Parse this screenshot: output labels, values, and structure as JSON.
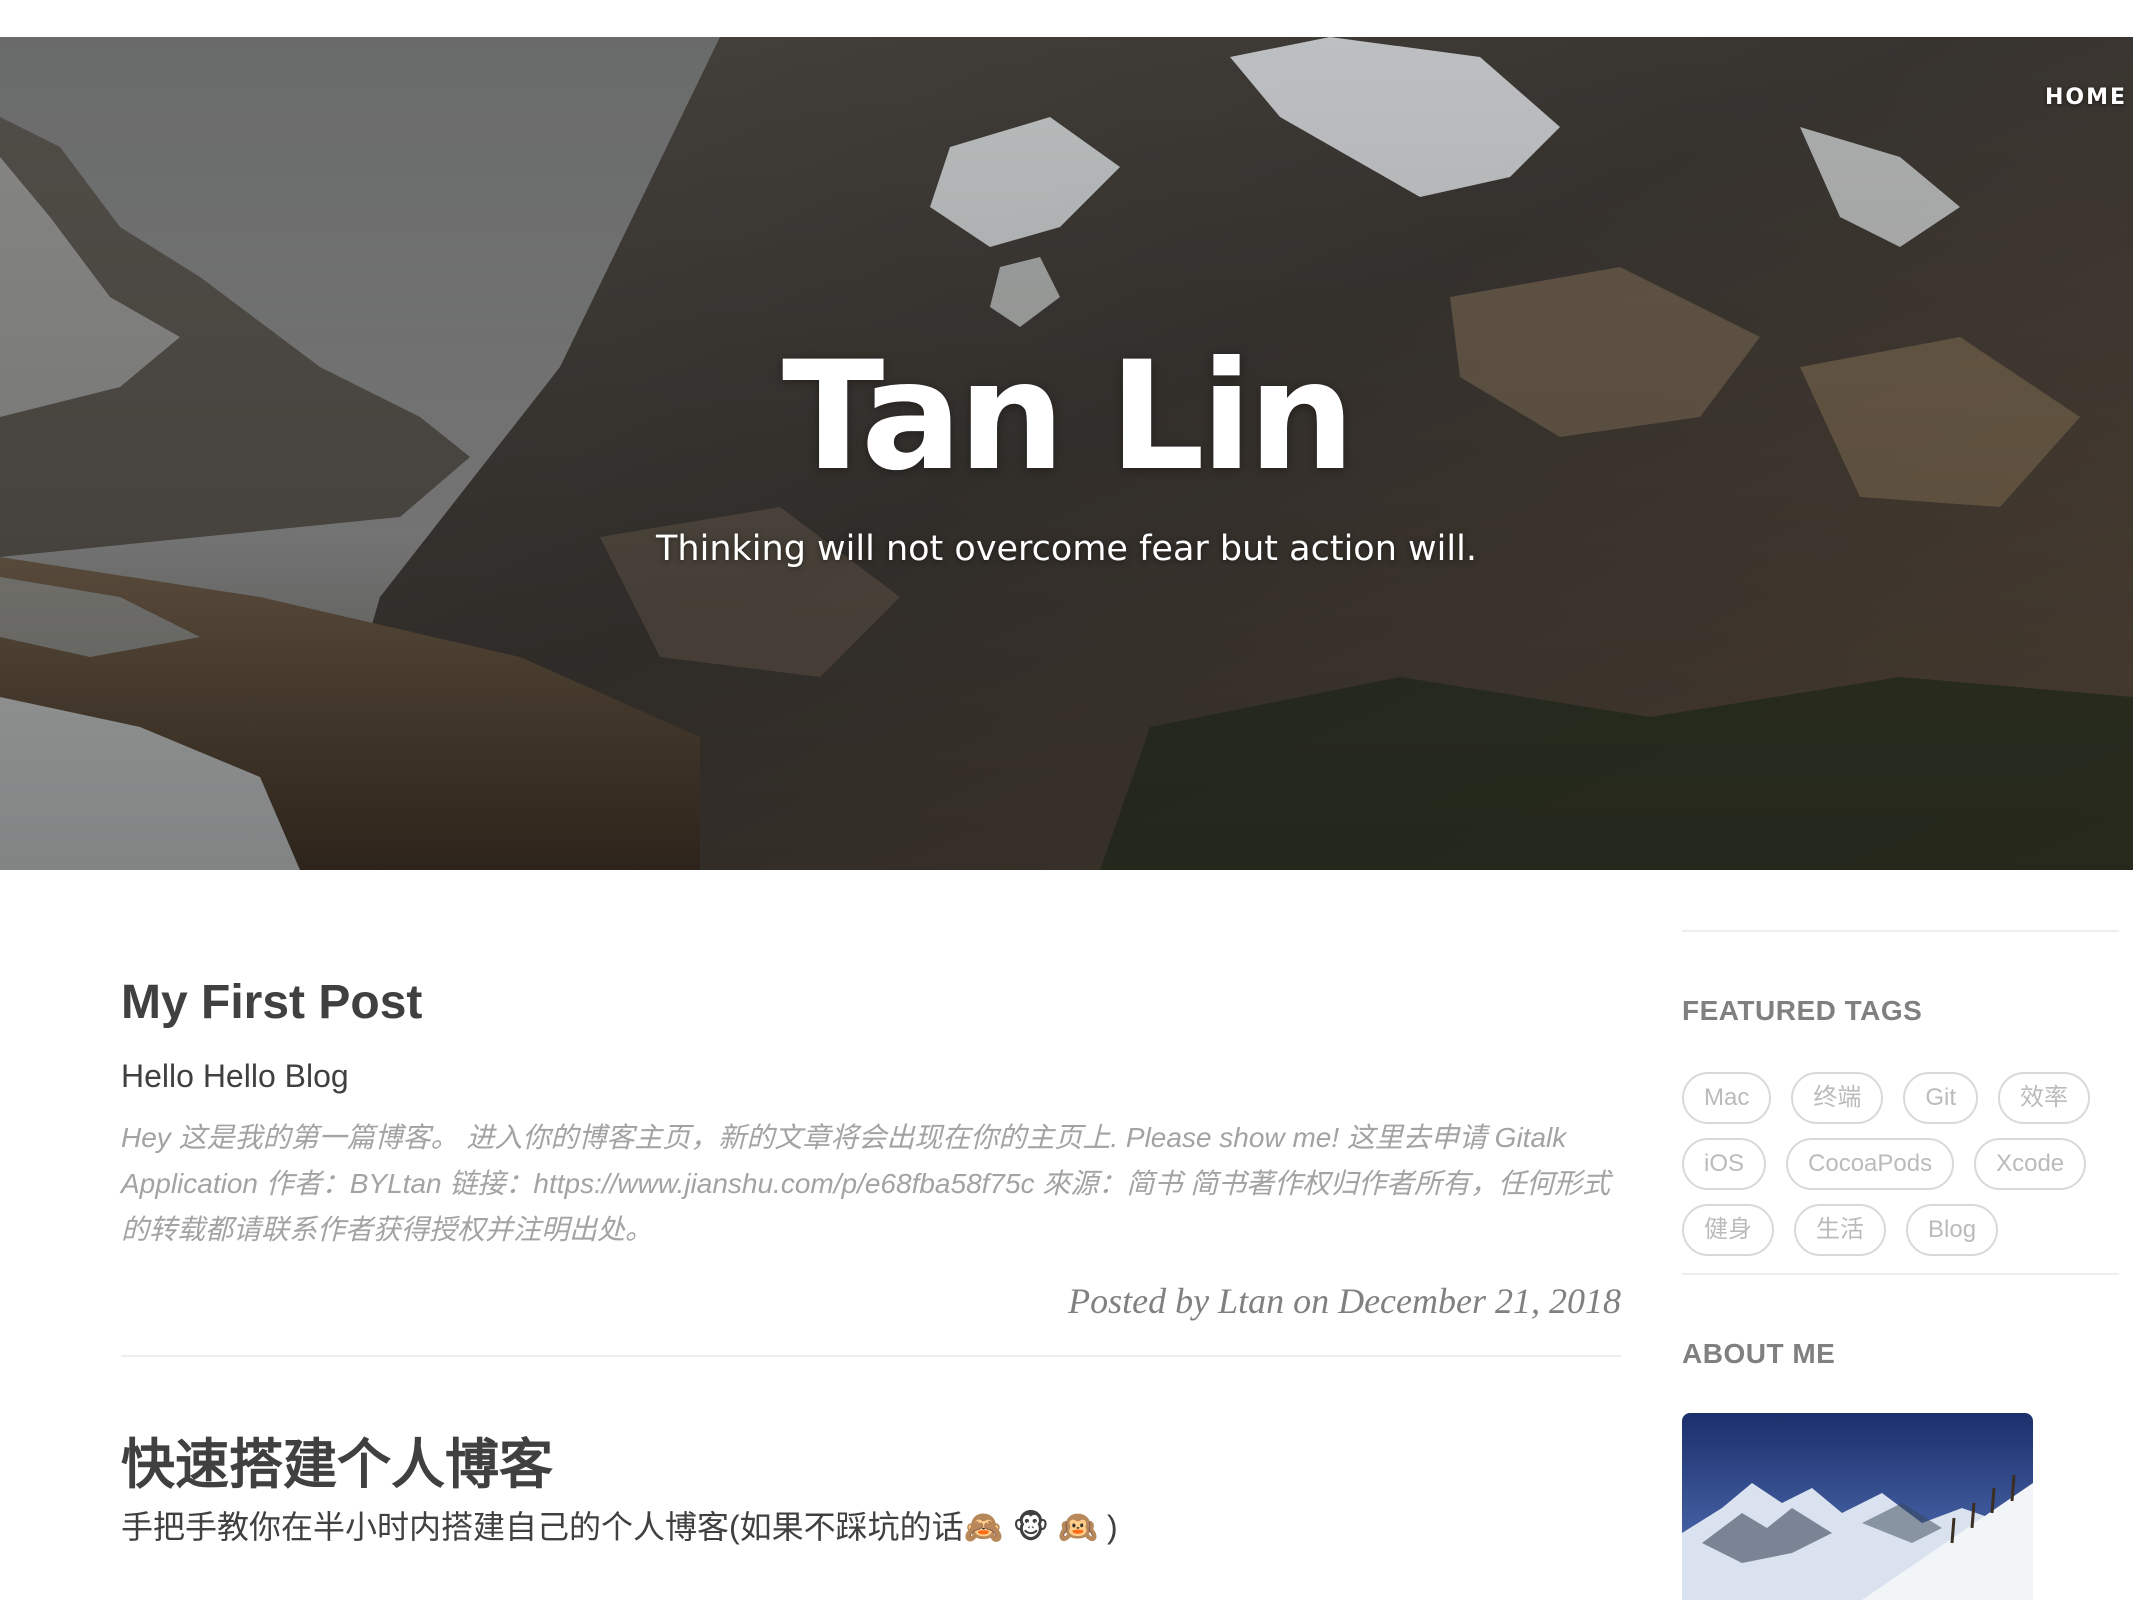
{
  "nav": {
    "home_label": "HOME"
  },
  "hero": {
    "title": "Tan Lin",
    "subtitle": "Thinking will not overcome fear but action will."
  },
  "posts": [
    {
      "title": "My First Post",
      "subtitle": "Hello Hello Blog",
      "excerpt": "Hey 这是我的第一篇博客。 进入你的博客主页，新的文章将会出现在你的主页上. Please show me! 这里去申请 Gitalk Application 作者：BYLtan 链接：https://www.jianshu.com/p/e68fba58f75c 來源：简书 简书著作权归作者所有，任何形式的转载都请联系作者获得授权并注明出处。",
      "meta": "Posted by Ltan on December 21, 2018"
    },
    {
      "title": "快速搭建个人博客",
      "subtitle": "手把手教你在半小时内搭建自己的个人博客(如果不踩坑的话🙈 🐵 🙉 )"
    }
  ],
  "sidebar": {
    "featured_tags_heading": "FEATURED TAGS",
    "tags": [
      "Mac",
      "终端",
      "Git",
      "效率",
      "iOS",
      "CocoaPods",
      "Xcode",
      "健身",
      "生活",
      "Blog"
    ],
    "about_heading": "ABOUT ME"
  },
  "colors": {
    "heading_text": "#404040",
    "excerpt_text": "#a3a3a3",
    "sidebar_heading": "#808080",
    "tag_border": "#d9d9d9",
    "hero_text": "#ffffff"
  },
  "icons": {
    "hero_background": "mountain-landscape-image",
    "about_avatar": "snowy-mountain-image"
  }
}
